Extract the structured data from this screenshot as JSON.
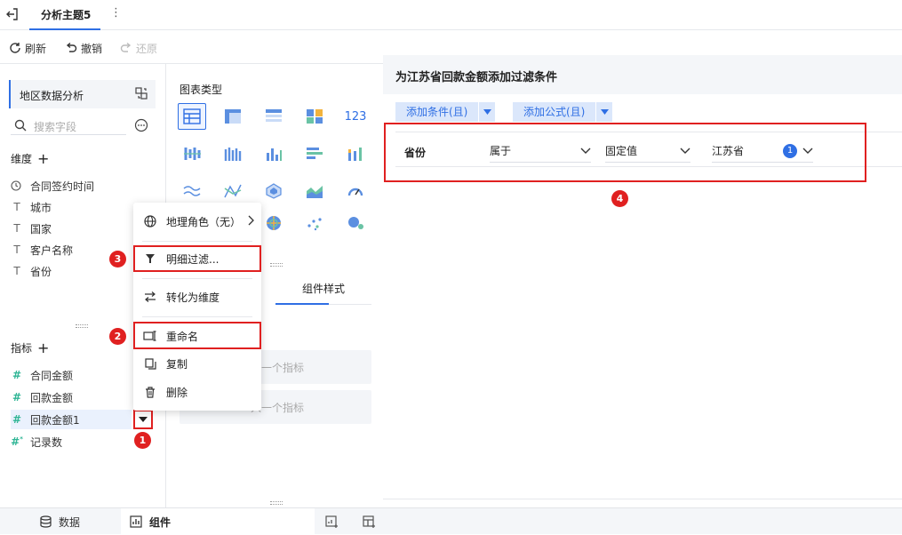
{
  "header": {
    "tab_title": "分析主题5"
  },
  "toolbar": {
    "refresh": "刷新",
    "undo": "撤销",
    "redo": "还原"
  },
  "left_panel": {
    "dataset_name": "地区数据分析",
    "search_placeholder": "搜索字段",
    "dimensions_title": "维度",
    "dimensions": [
      {
        "label": "合同签约时间",
        "icon": "clock-icon"
      },
      {
        "label": "城市",
        "icon": "text-type-icon"
      },
      {
        "label": "国家",
        "icon": "text-type-icon"
      },
      {
        "label": "客户名称",
        "icon": "text-type-icon"
      },
      {
        "label": "省份",
        "icon": "text-type-icon"
      }
    ],
    "metrics_title": "指标",
    "metrics": [
      {
        "label": "合同金额",
        "icon": "number-type-icon"
      },
      {
        "label": "回款金额",
        "icon": "number-type-icon"
      },
      {
        "label": "回款金额1",
        "icon": "number-type-icon",
        "selected": true
      },
      {
        "label": "记录数",
        "icon": "calc-number-icon"
      }
    ]
  },
  "middle_panel": {
    "chart_type_label": "图表类型",
    "tab_style": "组件样式",
    "slot_placeholder_1": "入一个指标",
    "slot_placeholder_2": "入一个指标",
    "number_chart_label": "123"
  },
  "context_menu": {
    "items": [
      {
        "label": "地理角色（无）",
        "icon": "globe-icon",
        "has_submenu": true
      },
      {
        "label": "明细过滤...",
        "icon": "filter-icon"
      },
      {
        "label": "转化为维度",
        "icon": "convert-icon"
      },
      {
        "label": "重命名",
        "icon": "rename-icon"
      },
      {
        "label": "复制",
        "icon": "copy-icon"
      },
      {
        "label": "删除",
        "icon": "delete-icon"
      }
    ]
  },
  "filter_panel": {
    "title": "为江苏省回款金额添加过滤条件",
    "add_condition": "添加条件(且)",
    "add_formula": "添加公式(且)",
    "condition": {
      "field": "省份",
      "operator": "属于",
      "value_type": "固定值",
      "value": "江苏省",
      "value_count": "1"
    }
  },
  "annotations": {
    "n1": "1",
    "n2": "2",
    "n3": "3",
    "n4": "4"
  },
  "bottom_bar": {
    "tab_data": "数据",
    "tab_component": "组件"
  },
  "colors": {
    "accent": "#2f6fe4",
    "annotation_red": "#e02020",
    "metric_green": "#2fb595"
  }
}
